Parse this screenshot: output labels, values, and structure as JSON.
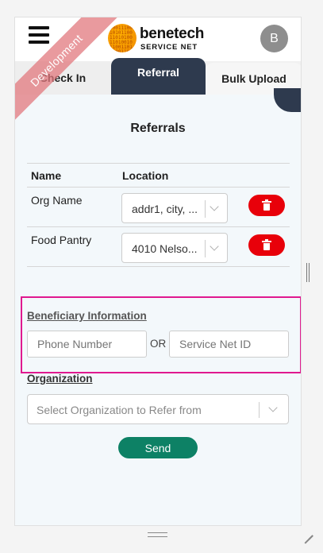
{
  "header": {
    "brand_name": "benetech",
    "brand_sub": "SERVICE NET",
    "logo_bits": "1001110010101100110101001101001011001101010011010010",
    "avatar_initial": "B"
  },
  "environment_ribbon": "Development",
  "tabs": [
    {
      "label": "Check In",
      "active": false
    },
    {
      "label": "Referral",
      "active": true
    },
    {
      "label": "Bulk Upload",
      "active": false
    }
  ],
  "referrals": {
    "title": "Referrals",
    "columns": {
      "name": "Name",
      "location": "Location"
    },
    "rows": [
      {
        "name": "Org Name",
        "location": "addr1, city, ..."
      },
      {
        "name": "Food Pantry",
        "location": "4010 Nelso..."
      }
    ]
  },
  "beneficiary": {
    "section_label": "Beneficiary Information",
    "phone_placeholder": "Phone Number",
    "or_label": "OR",
    "snid_placeholder": "Service Net ID"
  },
  "organization": {
    "section_label": "Organization",
    "select_placeholder": "Select Organization to Refer from"
  },
  "send_label": "Send",
  "colors": {
    "active_tab": "#2e3a4e",
    "delete_button": "#e8000a",
    "send_button": "#0d8165",
    "highlight_box": "#e0198f"
  }
}
